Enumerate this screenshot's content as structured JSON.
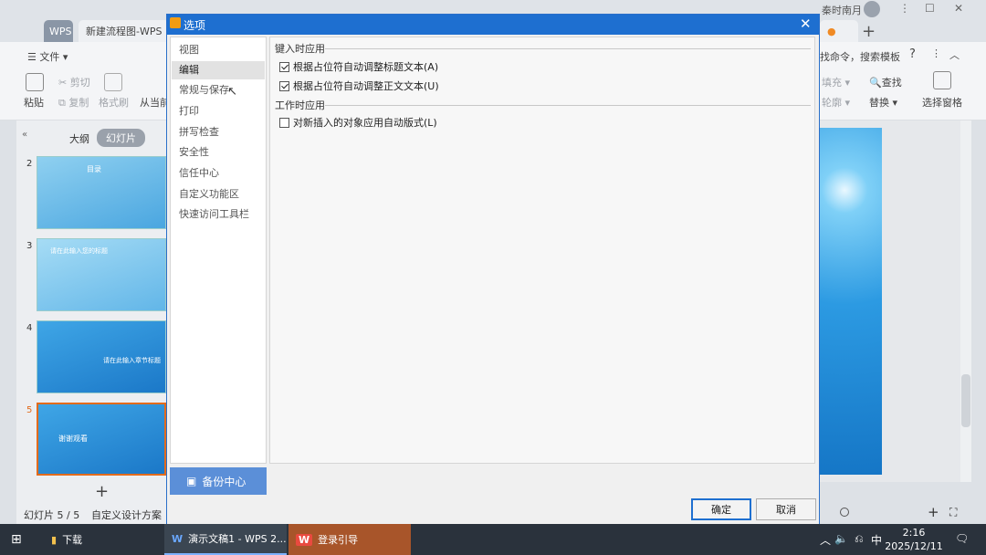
{
  "window": {
    "tabs": [
      "WPS",
      "新建流程图-WPS"
    ],
    "user": "秦时南月",
    "new_tab_symbol": "+"
  },
  "ribbon": {
    "file_label": "文件",
    "paste_label": "粘贴",
    "cut_label": "剪切",
    "copy_label": "复制",
    "format_painter_label": "格式刷",
    "from_current_label": "从当前",
    "search_command_label": "找命令，搜索模板",
    "fill_label": "填充",
    "find_label": "查找",
    "outline_label": "轮廓",
    "replace_label": "替换",
    "selection_pane_label": "选择窗格"
  },
  "left_panel": {
    "tab_outline": "大纲",
    "tab_slides": "幻灯片",
    "slide_numbers": [
      "2",
      "3",
      "4",
      "5"
    ],
    "thumb4_text": "请在此输入章节标题",
    "thumb5_text": "谢谢观看",
    "thumb3_text": "请在此输入您的标题",
    "thumb2_text": "目录"
  },
  "status": {
    "slide_counter": "幻灯片 5 / 5",
    "design": "自定义设计方案"
  },
  "dialog": {
    "title": "选项",
    "nav_items": [
      "视图",
      "编辑",
      "常规与保存",
      "打印",
      "拼写检查",
      "安全性",
      "信任中心",
      "自定义功能区",
      "快速访问工具栏"
    ],
    "active_nav": "编辑",
    "backup_label": "备份中心",
    "section1_title": "键入时应用",
    "option1_label": "根据占位符自动调整标题文本(A)",
    "option1_checked": true,
    "option2_label": "根据占位符自动调整正文文本(U)",
    "option2_checked": true,
    "section2_title": "工作时应用",
    "option3_label": "对新插入的对象应用自动版式(L)",
    "option3_checked": false,
    "ok_label": "确定",
    "cancel_label": "取消"
  },
  "taskbar": {
    "downloads_label": "下载",
    "wps_label": "演示文稿1 - WPS 2...",
    "login_label": "登录引导",
    "ime_label": "中",
    "time": "2:16",
    "date": "2025/12/11"
  },
  "colors": {
    "dialog_title": "#1e6fd0",
    "backup_button": "#5b8fd8",
    "selected_slide_border": "#e26b1c",
    "taskbar": "#2a323c"
  }
}
